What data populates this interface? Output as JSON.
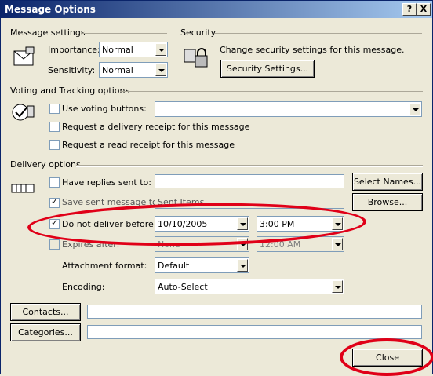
{
  "window": {
    "title": "Message Options",
    "help": "?",
    "close": "X"
  },
  "message_settings": {
    "heading": "Message settings",
    "importance_label": "Importance:",
    "importance": "Normal",
    "sensitivity_label": "Sensitivity:",
    "sensitivity": "Normal"
  },
  "security": {
    "heading": "Security",
    "text": "Change security settings for this message.",
    "button": "Security Settings..."
  },
  "voting": {
    "heading": "Voting and Tracking options",
    "use_voting": "Use voting buttons:",
    "voting_value": "",
    "delivery_receipt": "Request a delivery receipt for this message",
    "read_receipt": "Request a read receipt for this message"
  },
  "delivery": {
    "heading": "Delivery options",
    "have_replies": "Have replies sent to:",
    "replies_value": "",
    "select_names": "Select Names...",
    "save_sent": "Save sent message to:",
    "save_sent_value": "Sent Items",
    "browse": "Browse...",
    "do_not_deliver": "Do not deliver before:",
    "deliver_date": "10/10/2005",
    "deliver_time": "3:00 PM",
    "expires": "Expires after:",
    "expires_date": "None",
    "expires_time": "12:00 AM",
    "attachment_label": "Attachment format:",
    "attachment": "Default",
    "encoding_label": "Encoding:",
    "encoding": "Auto-Select"
  },
  "contacts_button": "Contacts...",
  "categories_button": "Categories...",
  "close_button": "Close",
  "colors": {
    "annotation": "#e00018",
    "titlebar": "#0a246a"
  }
}
